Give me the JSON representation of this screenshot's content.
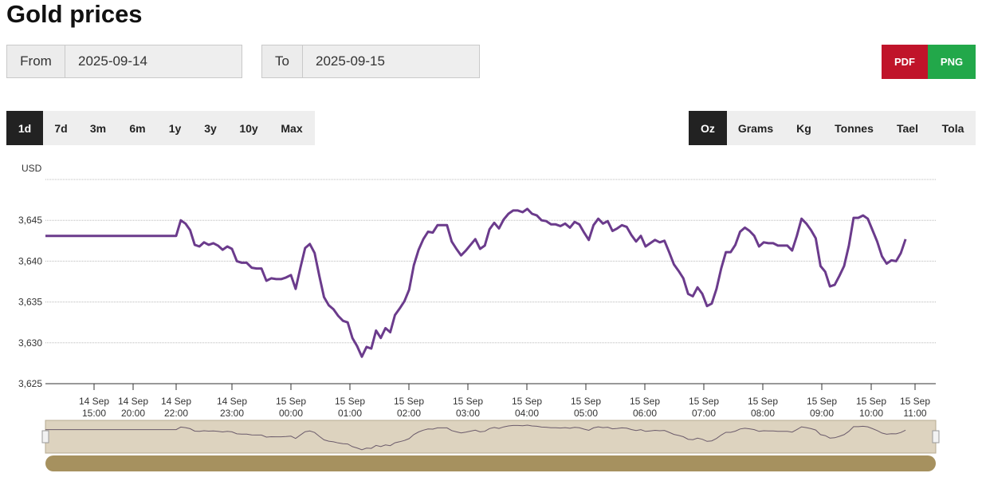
{
  "page": {
    "title": "Gold prices"
  },
  "date_range": {
    "from_label": "From",
    "from_value": "2025-09-14",
    "to_label": "To",
    "to_value": "2025-09-15"
  },
  "export": {
    "pdf_label": "PDF",
    "png_label": "PNG",
    "pdf_color": "#c0142a",
    "png_color": "#22a84a"
  },
  "range_buttons": [
    {
      "label": "1d",
      "active": true
    },
    {
      "label": "7d",
      "active": false
    },
    {
      "label": "3m",
      "active": false
    },
    {
      "label": "6m",
      "active": false
    },
    {
      "label": "1y",
      "active": false
    },
    {
      "label": "3y",
      "active": false
    },
    {
      "label": "10y",
      "active": false
    },
    {
      "label": "Max",
      "active": false
    }
  ],
  "unit_buttons": [
    {
      "label": "Oz",
      "active": true
    },
    {
      "label": "Grams",
      "active": false
    },
    {
      "label": "Kg",
      "active": false
    },
    {
      "label": "Tonnes",
      "active": false
    },
    {
      "label": "Tael",
      "active": false
    },
    {
      "label": "Tola",
      "active": false
    }
  ],
  "chart_data": {
    "type": "line",
    "ylabel": "USD",
    "ylim": [
      3625,
      3650
    ],
    "yticks": [
      3625,
      3630,
      3635,
      3640,
      3645
    ],
    "ytick_labels": [
      "3,625",
      "3,630",
      "3,635",
      "3,640",
      "3,645"
    ],
    "grid": true,
    "line_color": "#6b3b8c",
    "x_tick_labels": [
      {
        "day": "14 Sep",
        "time": "15:00"
      },
      {
        "day": "14 Sep",
        "time": "20:00"
      },
      {
        "day": "14 Sep",
        "time": "22:00"
      },
      {
        "day": "14 Sep",
        "time": "23:00"
      },
      {
        "day": "15 Sep",
        "time": "00:00"
      },
      {
        "day": "15 Sep",
        "time": "01:00"
      },
      {
        "day": "15 Sep",
        "time": "02:00"
      },
      {
        "day": "15 Sep",
        "time": "03:00"
      },
      {
        "day": "15 Sep",
        "time": "04:00"
      },
      {
        "day": "15 Sep",
        "time": "05:00"
      },
      {
        "day": "15 Sep",
        "time": "06:00"
      },
      {
        "day": "15 Sep",
        "time": "07:00"
      },
      {
        "day": "15 Sep",
        "time": "08:00"
      },
      {
        "day": "15 Sep",
        "time": "09:00"
      },
      {
        "day": "15 Sep",
        "time": "10:00"
      },
      {
        "day": "15 Sep",
        "time": "11:00"
      }
    ],
    "x": [
      "15:00",
      "16:00",
      "17:00",
      "18:00",
      "19:00",
      "20:00",
      "21:00",
      "22:00",
      "22:05",
      "22:10",
      "22:15",
      "22:20",
      "22:25",
      "22:30",
      "22:35",
      "22:40",
      "22:45",
      "22:50",
      "22:55",
      "23:00",
      "23:05",
      "23:10",
      "23:15",
      "23:20",
      "23:25",
      "23:30",
      "23:35",
      "23:40",
      "23:45",
      "23:50",
      "23:55",
      "00:00",
      "00:05",
      "00:10",
      "00:15",
      "00:20",
      "00:25",
      "00:30",
      "00:35",
      "00:40",
      "00:45",
      "00:50",
      "00:55",
      "01:00",
      "01:05",
      "01:10",
      "01:15",
      "01:20",
      "01:25",
      "01:30",
      "01:35",
      "01:40",
      "01:45",
      "01:50",
      "01:55",
      "02:00",
      "02:05",
      "02:10",
      "02:15",
      "02:20",
      "02:25",
      "02:30",
      "02:35",
      "02:40",
      "02:45",
      "02:50",
      "02:55",
      "03:00",
      "03:05",
      "03:10",
      "03:15",
      "03:20",
      "03:25",
      "03:30",
      "03:35",
      "03:40",
      "03:45",
      "03:50",
      "03:55",
      "04:00",
      "04:05",
      "04:10",
      "04:15",
      "04:20",
      "04:25",
      "04:30",
      "04:35",
      "04:40",
      "04:45",
      "04:50",
      "04:55",
      "05:00",
      "05:05",
      "05:10",
      "05:15",
      "05:20",
      "05:25",
      "05:30",
      "05:35",
      "05:40",
      "05:45",
      "05:50",
      "05:55",
      "06:00",
      "06:05",
      "06:10",
      "06:15",
      "06:20",
      "06:25",
      "06:30",
      "06:35",
      "06:40",
      "06:45",
      "06:50",
      "06:55",
      "07:00",
      "07:05",
      "07:10",
      "07:15",
      "07:20",
      "07:25",
      "07:30",
      "07:35",
      "07:40",
      "07:45",
      "07:50",
      "07:55",
      "08:00",
      "08:05",
      "08:10",
      "08:15",
      "08:20",
      "08:25",
      "08:30",
      "08:35",
      "08:40",
      "08:45",
      "08:50",
      "08:55",
      "09:00",
      "09:05",
      "09:10",
      "09:15",
      "09:20",
      "09:25",
      "09:30",
      "09:35",
      "09:40",
      "09:45",
      "09:50",
      "09:55",
      "10:00",
      "10:05",
      "10:10",
      "10:15",
      "10:20",
      "10:25",
      "10:30",
      "10:35",
      "10:40",
      "10:45",
      "10:50",
      "10:55",
      "11:00",
      "11:05",
      "11:10",
      "11:15",
      "11:20"
    ],
    "values": [
      3643.1,
      3643.1,
      3643.1,
      3643.1,
      3643.1,
      3643.1,
      3643.1,
      3643.1,
      3645.0,
      3644.6,
      3643.8,
      3642.0,
      3641.8,
      3642.3,
      3642.0,
      3642.2,
      3641.9,
      3641.4,
      3641.8,
      3641.5,
      3640.0,
      3639.8,
      3639.8,
      3639.2,
      3639.1,
      3639.1,
      3637.6,
      3637.9,
      3637.8,
      3637.8,
      3638.0,
      3638.3,
      3636.6,
      3639.2,
      3641.6,
      3642.1,
      3641.0,
      3638.2,
      3635.6,
      3634.6,
      3634.1,
      3633.3,
      3632.7,
      3632.5,
      3630.6,
      3629.6,
      3628.3,
      3629.5,
      3629.3,
      3631.5,
      3630.6,
      3631.8,
      3631.3,
      3633.4,
      3634.2,
      3635.1,
      3636.5,
      3639.5,
      3641.4,
      3642.7,
      3643.6,
      3643.5,
      3644.4,
      3644.4,
      3644.4,
      3642.4,
      3641.5,
      3640.7,
      3641.3,
      3642.0,
      3642.7,
      3641.5,
      3641.9,
      3643.9,
      3644.7,
      3644.0,
      3645.1,
      3645.8,
      3646.2,
      3646.2,
      3646.0,
      3646.4,
      3645.8,
      3645.6,
      3645.0,
      3644.9,
      3644.5,
      3644.5,
      3644.3,
      3644.6,
      3644.1,
      3644.8,
      3644.5,
      3643.5,
      3642.6,
      3644.4,
      3645.2,
      3644.6,
      3644.9,
      3643.7,
      3644.0,
      3644.4,
      3644.2,
      3643.2,
      3642.4,
      3643.1,
      3641.8,
      3642.2,
      3642.6,
      3642.3,
      3642.5,
      3641.1,
      3639.6,
      3638.8,
      3637.9,
      3636.0,
      3635.7,
      3636.8,
      3636.0,
      3634.5,
      3634.8,
      3636.6,
      3639.1,
      3641.1,
      3641.1,
      3642.0,
      3643.6,
      3644.1,
      3643.7,
      3643.1,
      3641.8,
      3642.3,
      3642.2,
      3642.2,
      3641.9,
      3641.9,
      3641.9,
      3641.3,
      3643.1,
      3645.2,
      3644.6,
      3643.8,
      3642.8,
      3639.4,
      3638.7,
      3636.9,
      3637.1,
      3638.2,
      3639.4,
      3641.9,
      3645.3,
      3645.3,
      3645.6,
      3645.2,
      3643.8,
      3642.4,
      3640.6,
      3639.7,
      3640.1,
      3640.0,
      3641.0,
      3642.7
    ]
  }
}
